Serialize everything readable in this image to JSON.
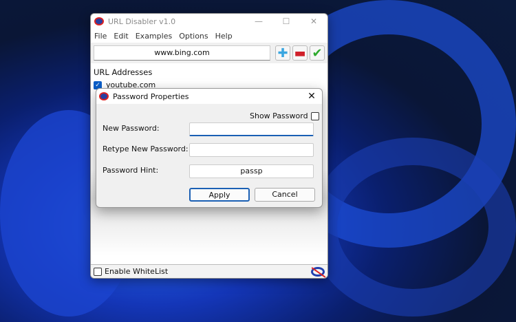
{
  "window": {
    "title": "URL Disabler v1.0",
    "menu": [
      "File",
      "Edit",
      "Examples",
      "Options",
      "Help"
    ],
    "url_value": "www.bing.com",
    "list_header": "URL Addresses",
    "items": [
      {
        "label": "youtube.com",
        "checked": true
      }
    ],
    "whitelist_label": "Enable WhiteList",
    "whitelist_checked": false
  },
  "dialog": {
    "title": "Password Properties",
    "show_password": "Show Password",
    "new_password_label": "New Password:",
    "retype_label": "Retype New Password:",
    "hint_label": "Password Hint:",
    "new_password": "",
    "retype": "",
    "hint": "passp",
    "apply": "Apply",
    "cancel": "Cancel"
  }
}
